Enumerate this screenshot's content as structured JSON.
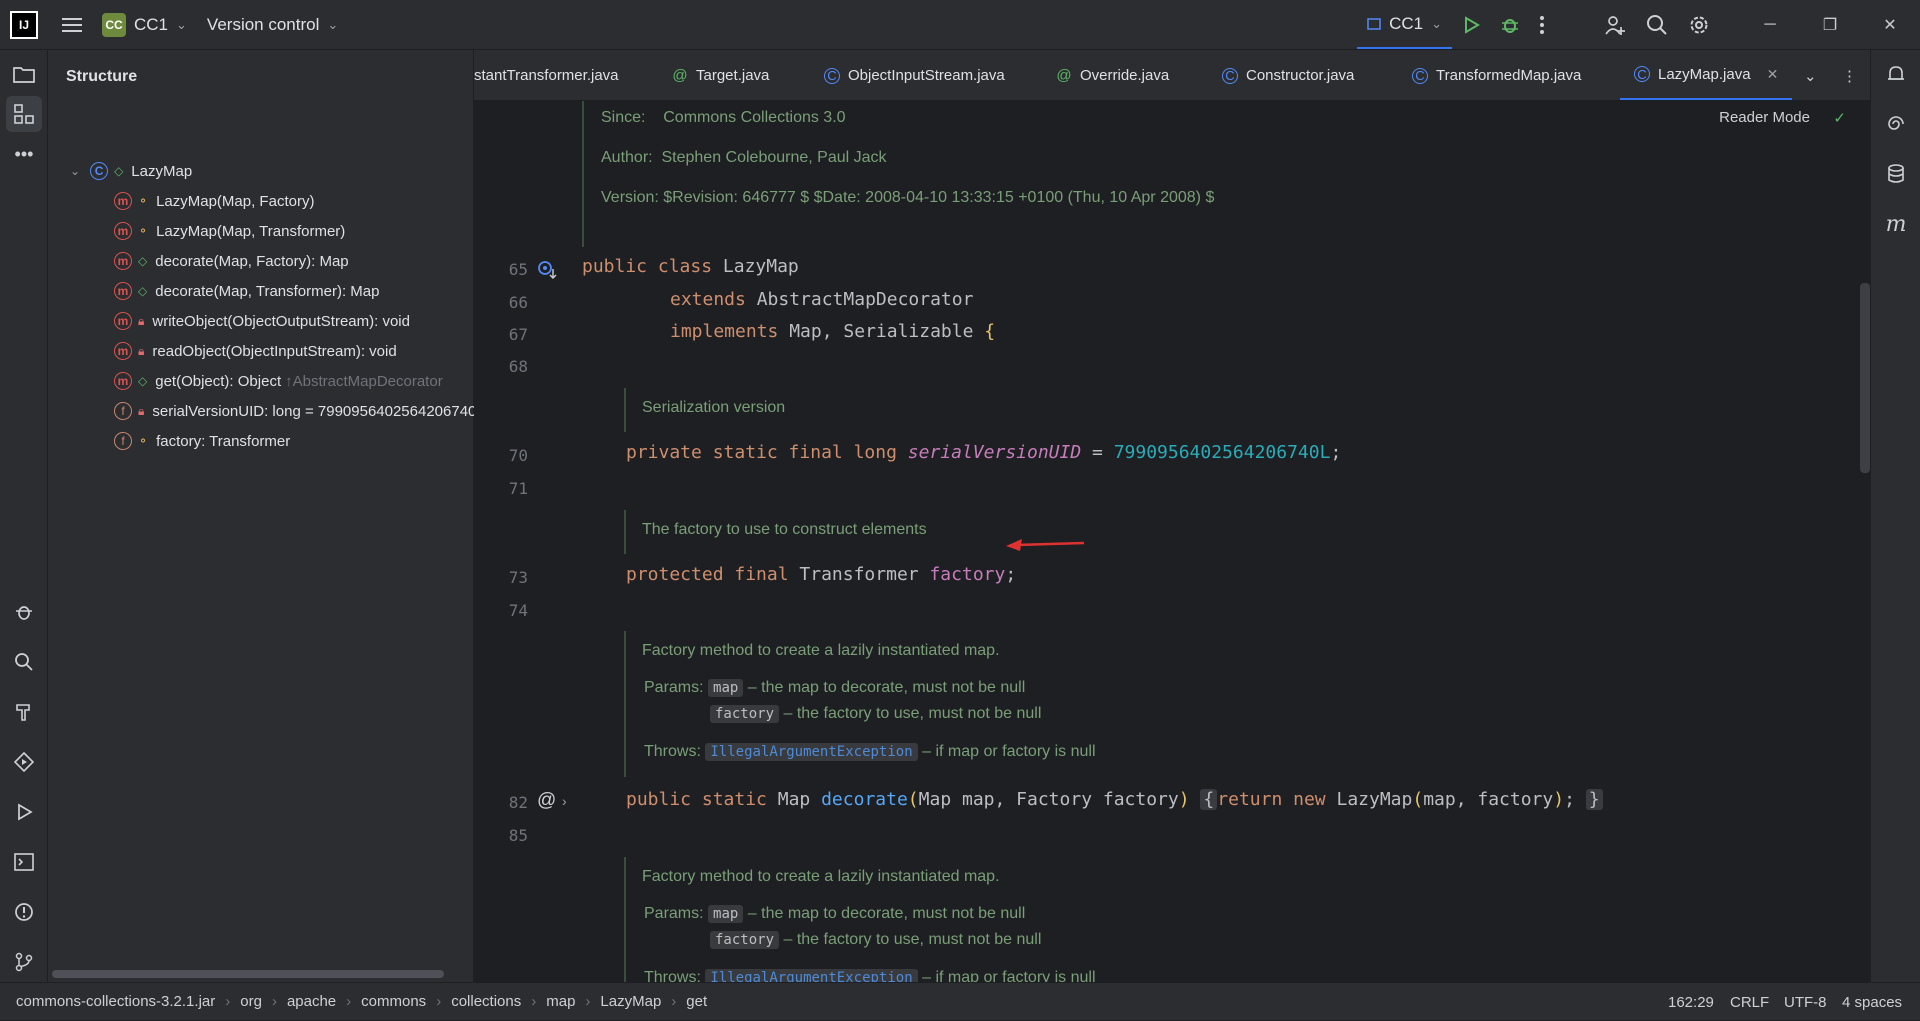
{
  "titlebar": {
    "logo": "IJ",
    "project_badge": "CC",
    "project_name": "CC1",
    "vcs_label": "Version control",
    "run_config": "CC1"
  },
  "structure": {
    "title": "Structure",
    "root": "LazyMap",
    "items": [
      {
        "label": "LazyMap(Map, Factory)",
        "kind": "method",
        "vis": "pkg"
      },
      {
        "label": "LazyMap(Map, Transformer)",
        "kind": "method",
        "vis": "pkg"
      },
      {
        "label": "decorate(Map, Factory): Map",
        "kind": "method-static",
        "vis": "pub"
      },
      {
        "label": "decorate(Map, Transformer): Map",
        "kind": "method-static",
        "vis": "pub"
      },
      {
        "label": "writeObject(ObjectOutputStream): void",
        "kind": "method",
        "vis": "priv"
      },
      {
        "label": "readObject(ObjectInputStream): void",
        "kind": "method",
        "vis": "priv"
      },
      {
        "label": "get(Object): Object",
        "suffix": "↑AbstractMapDecorator",
        "kind": "method",
        "vis": "pub"
      },
      {
        "label": "serialVersionUID: long = 7990956402564206740",
        "kind": "field-static",
        "vis": "priv"
      },
      {
        "label": "factory: Transformer",
        "kind": "field",
        "vis": "pkg"
      }
    ]
  },
  "tabs": [
    {
      "label": "stantTransformer.java",
      "icon": "class-icon"
    },
    {
      "label": "Target.java",
      "icon": "annotation-icon"
    },
    {
      "label": "ObjectInputStream.java",
      "icon": "class-icon"
    },
    {
      "label": "Override.java",
      "icon": "annotation-icon"
    },
    {
      "label": "Constructor.java",
      "icon": "class-icon"
    },
    {
      "label": "TransformedMap.java",
      "icon": "class-icon"
    },
    {
      "label": "LazyMap.java",
      "icon": "class-icon",
      "active": true
    }
  ],
  "editor": {
    "reader_mode": "Reader Mode",
    "doc_since_label": "Since:",
    "doc_since_value": "Commons Collections 3.0",
    "doc_author_label": "Author:",
    "doc_author_value": "Stephen Colebourne, Paul Jack",
    "doc_version_label": "Version:",
    "doc_version_value": "$Revision: 646777 $ $Date: 2008-04-10 13:33:15 +0100 (Thu, 10 Apr 2008) $",
    "ln": [
      "65",
      "66",
      "67",
      "68",
      "70",
      "71",
      "73",
      "74",
      "82",
      "85"
    ],
    "l65": {
      "kw": "public class",
      "name": "LazyMap"
    },
    "l66": {
      "kw": "extends",
      "name": "AbstractMapDecorator"
    },
    "l67": {
      "kw": "implements",
      "name": "Map, Serializable",
      "brace": "{"
    },
    "doc_serial": "Serialization version",
    "l70": {
      "kw": "private static final long",
      "field": "serialVersionUID",
      "eq": " = ",
      "num": "7990956402564206740L",
      "end": ";"
    },
    "doc_factory": "The factory to use to construct elements",
    "l73": {
      "kw": "protected final",
      "type": "Transformer",
      "field": "factory",
      "end": ";"
    },
    "doc_method": "Factory method to create a lazily instantiated map.",
    "params_label": "Params:",
    "param_map": "map",
    "param_map_desc": "– the map to decorate, must not be null",
    "param_factory": "factory",
    "param_factory_desc": "– the factory to use, must not be null",
    "throws_label": "Throws:",
    "throws_type": "IllegalArgumentException",
    "throws_desc": "– if map or factory is null",
    "l82": {
      "kw": "public static",
      "type": "Map",
      "fn": "decorate",
      "args": "Map map, Factory factory",
      "body_open": "{",
      "ret": "return new",
      "ctor": "LazyMap",
      "ctor_args": "map, factory",
      "body_close": "}"
    },
    "doc_method2": "Factory method to create a lazily instantiated map.",
    "param_map2_desc": "– the map to decorate, must not be null",
    "param_factory2_desc": "– the factory to use, must not be null",
    "throws2_desc": "– if map or factory is null"
  },
  "statusbar": {
    "crumbs": [
      "commons-collections-3.2.1.jar",
      "org",
      "apache",
      "commons",
      "collections",
      "map",
      "LazyMap",
      "get"
    ],
    "position": "162:29",
    "line_sep": "CRLF",
    "encoding": "UTF-8",
    "indent": "4 spaces"
  },
  "colors": {
    "accent": "#3574f0",
    "arrow": "#e03131",
    "bg": "#1e1f22",
    "panel": "#2b2d30"
  }
}
